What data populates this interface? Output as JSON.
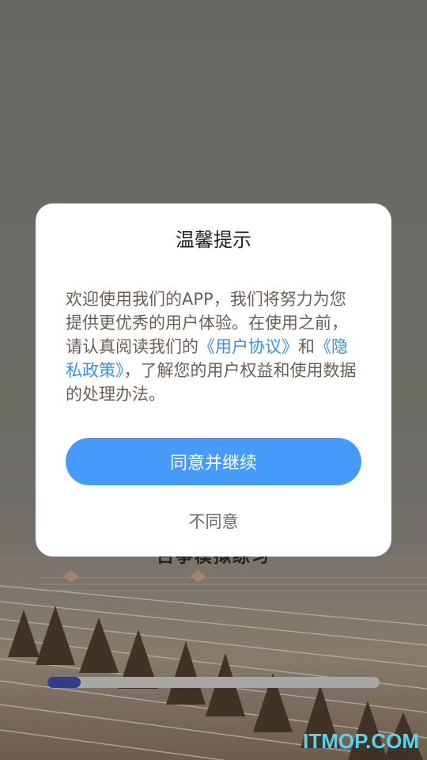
{
  "background": {
    "title": "古筝模拟练习",
    "progress_percent": 10,
    "watermark": "ITMOP.COM"
  },
  "dialog": {
    "title": "温馨提示",
    "body": {
      "text_1": "欢迎使用我们的APP，我们将努力为您提供更优秀的用户体验。在使用之前，请认真阅读我们的",
      "link_user_agreement": "《用户协议》",
      "text_2": "和",
      "link_privacy_policy": "《隐私政策》",
      "text_3": "，了解您的用户权益和使用数据的处理办法。"
    },
    "agree_label": "同意并继续",
    "disagree_label": "不同意"
  },
  "colors": {
    "accent": "#469bfa",
    "link": "#3a8fe6",
    "progress": "#2f3e86",
    "watermark": "#5ad2ee"
  }
}
